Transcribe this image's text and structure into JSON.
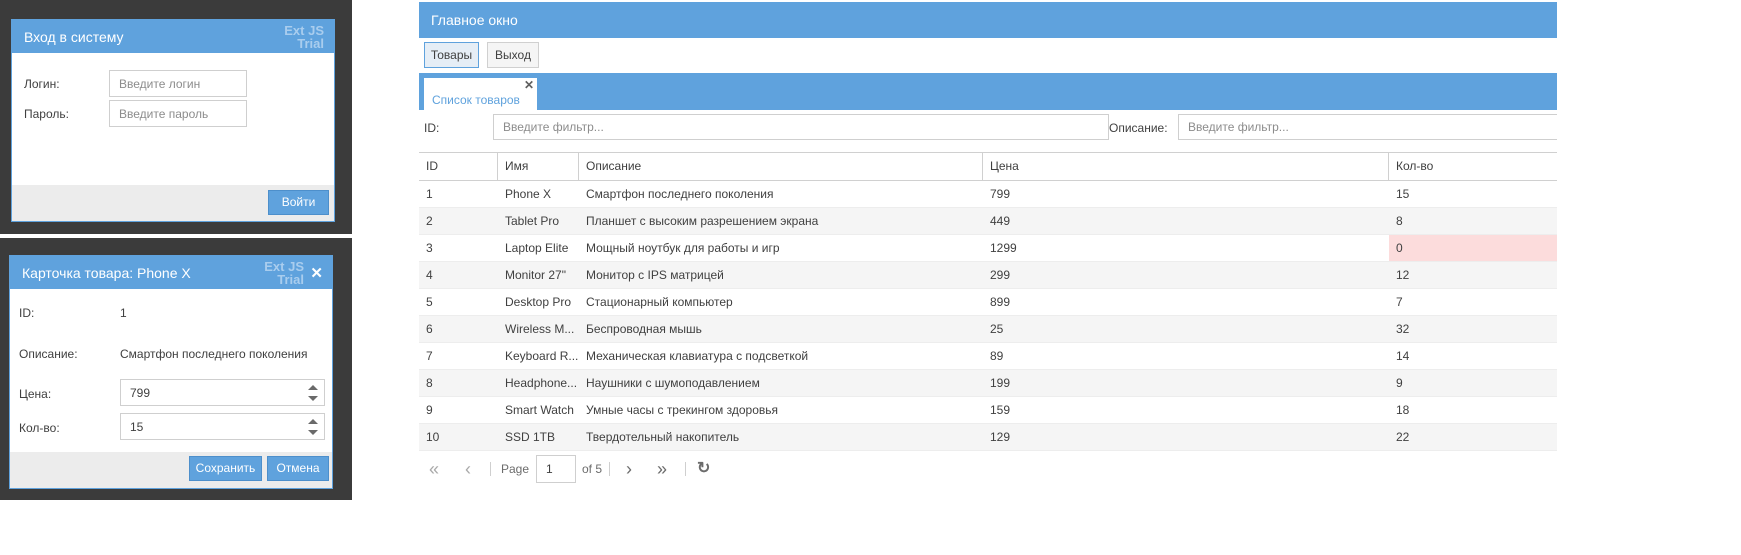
{
  "login": {
    "title": "Вход в систему",
    "trial_line1": "Ext JS",
    "trial_line2": "Trial",
    "login_label": "Логин:",
    "login_placeholder": "Введите логин",
    "password_label": "Пароль:",
    "password_placeholder": "Введите пароль",
    "submit_label": "Войти"
  },
  "card": {
    "title": "Карточка товара: Phone X",
    "trial_line1": "Ext JS",
    "trial_line2": "Trial",
    "close_glyph": "✕",
    "id_label": "ID:",
    "id_value": "1",
    "desc_label": "Описание:",
    "desc_value": "Смартфон последнего поколения",
    "price_label": "Цена:",
    "price_value": "799",
    "qty_label": "Кол-во:",
    "qty_value": "15",
    "save_label": "Сохранить",
    "cancel_label": "Отмена"
  },
  "main": {
    "title": "Главное окно",
    "toolbar": {
      "products_label": "Товары",
      "exit_label": "Выход"
    },
    "tab": {
      "label": "Список товаров",
      "close_glyph": "✕"
    },
    "filters": {
      "id_label": "ID:",
      "id_placeholder": "Введите фильтр...",
      "desc_label": "Описание:",
      "desc_placeholder": "Введите фильтр..."
    },
    "columns": [
      "ID",
      "Имя",
      "Описание",
      "Цена",
      "Кол-во"
    ],
    "rows": [
      {
        "id": "1",
        "name": "Phone X",
        "desc": "Смартфон последнего поколения",
        "price": "799",
        "qty": "15"
      },
      {
        "id": "2",
        "name": "Tablet Pro",
        "desc": "Планшет с высоким разрешением экрана",
        "price": "449",
        "qty": "8"
      },
      {
        "id": "3",
        "name": "Laptop Elite",
        "desc": "Мощный ноутбук для работы и игр",
        "price": "1299",
        "qty": "0"
      },
      {
        "id": "4",
        "name": "Monitor 27\"",
        "desc": "Монитор с IPS матрицей",
        "price": "299",
        "qty": "12"
      },
      {
        "id": "5",
        "name": "Desktop Pro",
        "desc": "Стационарный компьютер",
        "price": "899",
        "qty": "7"
      },
      {
        "id": "6",
        "name": "Wireless M...",
        "desc": "Беспроводная мышь",
        "price": "25",
        "qty": "32"
      },
      {
        "id": "7",
        "name": "Keyboard R...",
        "desc": "Механическая клавиатура с подсветкой",
        "price": "89",
        "qty": "14"
      },
      {
        "id": "8",
        "name": "Headphone...",
        "desc": "Наушники с шумоподавлением",
        "price": "199",
        "qty": "9"
      },
      {
        "id": "9",
        "name": "Smart Watch",
        "desc": "Умные часы с трекингом здоровья",
        "price": "159",
        "qty": "18"
      },
      {
        "id": "10",
        "name": "SSD 1TB",
        "desc": "Твердотельный накопитель",
        "price": "129",
        "qty": "22"
      }
    ],
    "pager": {
      "page_label": "Page",
      "page_value": "1",
      "of_label": "of 5",
      "first_glyph": "«",
      "prev_glyph": "‹",
      "next_glyph": "›",
      "last_glyph": "»",
      "refresh_glyph": "↻"
    }
  },
  "colors": {
    "accent": "#5fa2dd",
    "warning_row": "#fcdcdc",
    "backdrop": "#3b3b3b"
  }
}
